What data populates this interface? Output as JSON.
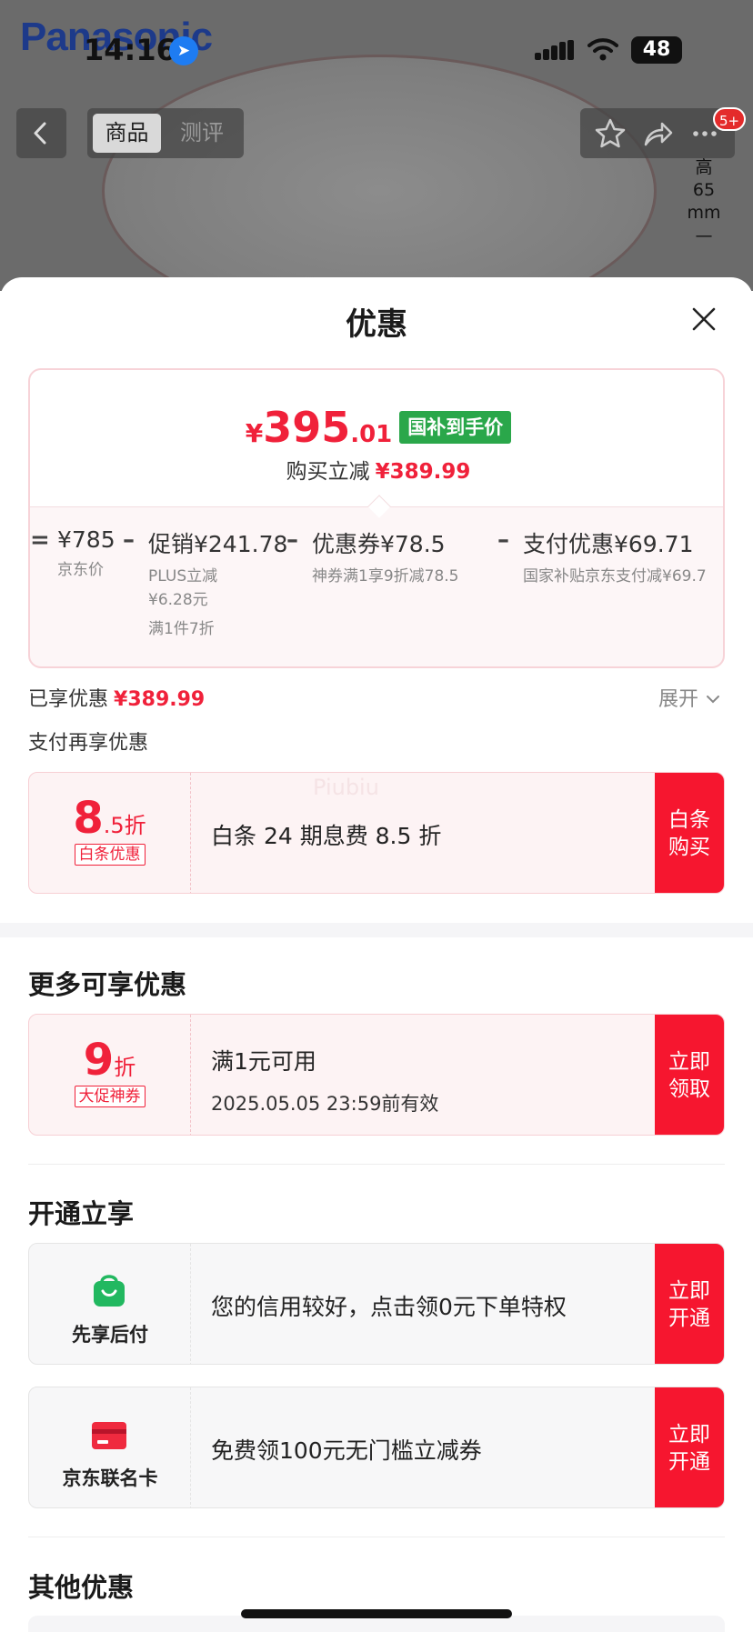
{
  "status_bar": {
    "time": "14:16",
    "battery": "48"
  },
  "background": {
    "brand": "Panasonic",
    "dimension_lines": [
      "高",
      "65",
      "mm"
    ]
  },
  "nav": {
    "tab_product": "商品",
    "tab_review": "测评",
    "badge": "5+"
  },
  "sheet": {
    "title": "优惠",
    "final_price": {
      "yen": "¥",
      "integer": "395",
      "decimal": ".01"
    },
    "gov_tag": "国补到手价",
    "reduce_label": "购买立减",
    "reduce_amount": "¥389.99",
    "formula": {
      "equals": "=",
      "items": [
        {
          "value": "¥785",
          "sub": [
            "京东价"
          ]
        },
        {
          "op": "–",
          "value": "促销¥241.78",
          "sub": [
            "PLUS立减",
            "¥6.28元",
            "满1件7折"
          ]
        },
        {
          "op": "–",
          "value": "优惠券¥78.5",
          "sub": [
            "神券满1享9折减78.5"
          ]
        },
        {
          "op": "–",
          "value": "支付优惠¥69.71",
          "sub": [
            "国家补贴京东支付减¥69.7"
          ]
        }
      ]
    },
    "enjoyed_label": "已享优惠",
    "enjoyed_amount": "¥389.99",
    "expand_label": "展开",
    "pay_more_label": "支付再享优惠",
    "baitiao": {
      "discount_big": "8",
      "discount_small": ".5折",
      "tag": "白条优惠",
      "text": "白条 24 期息费 8.5 折",
      "button": [
        "白条",
        "购买"
      ],
      "watermark": "Piubiu"
    },
    "more_title": "更多可享优惠",
    "coupon": {
      "discount_big": "9",
      "discount_small": "折",
      "tag": "大促神券",
      "text": "满1元可用",
      "validity": "2025.05.05 23:59前有效",
      "button": [
        "立即",
        "领取"
      ]
    },
    "open_title": "开通立享",
    "services": [
      {
        "icon": "green-bag-icon",
        "label": "先享后付",
        "text": "您的信用较好，点击领0元下单特权",
        "button": [
          "立即",
          "开通"
        ]
      },
      {
        "icon": "red-card-icon",
        "label": "京东联名卡",
        "text": "免费领100元无门槛立减券",
        "button": [
          "立即",
          "开通"
        ]
      }
    ],
    "other_title": "其他优惠"
  },
  "colors": {
    "accent": "#f0213a",
    "button": "#f6162f",
    "gov_green": "#2aa74a"
  }
}
